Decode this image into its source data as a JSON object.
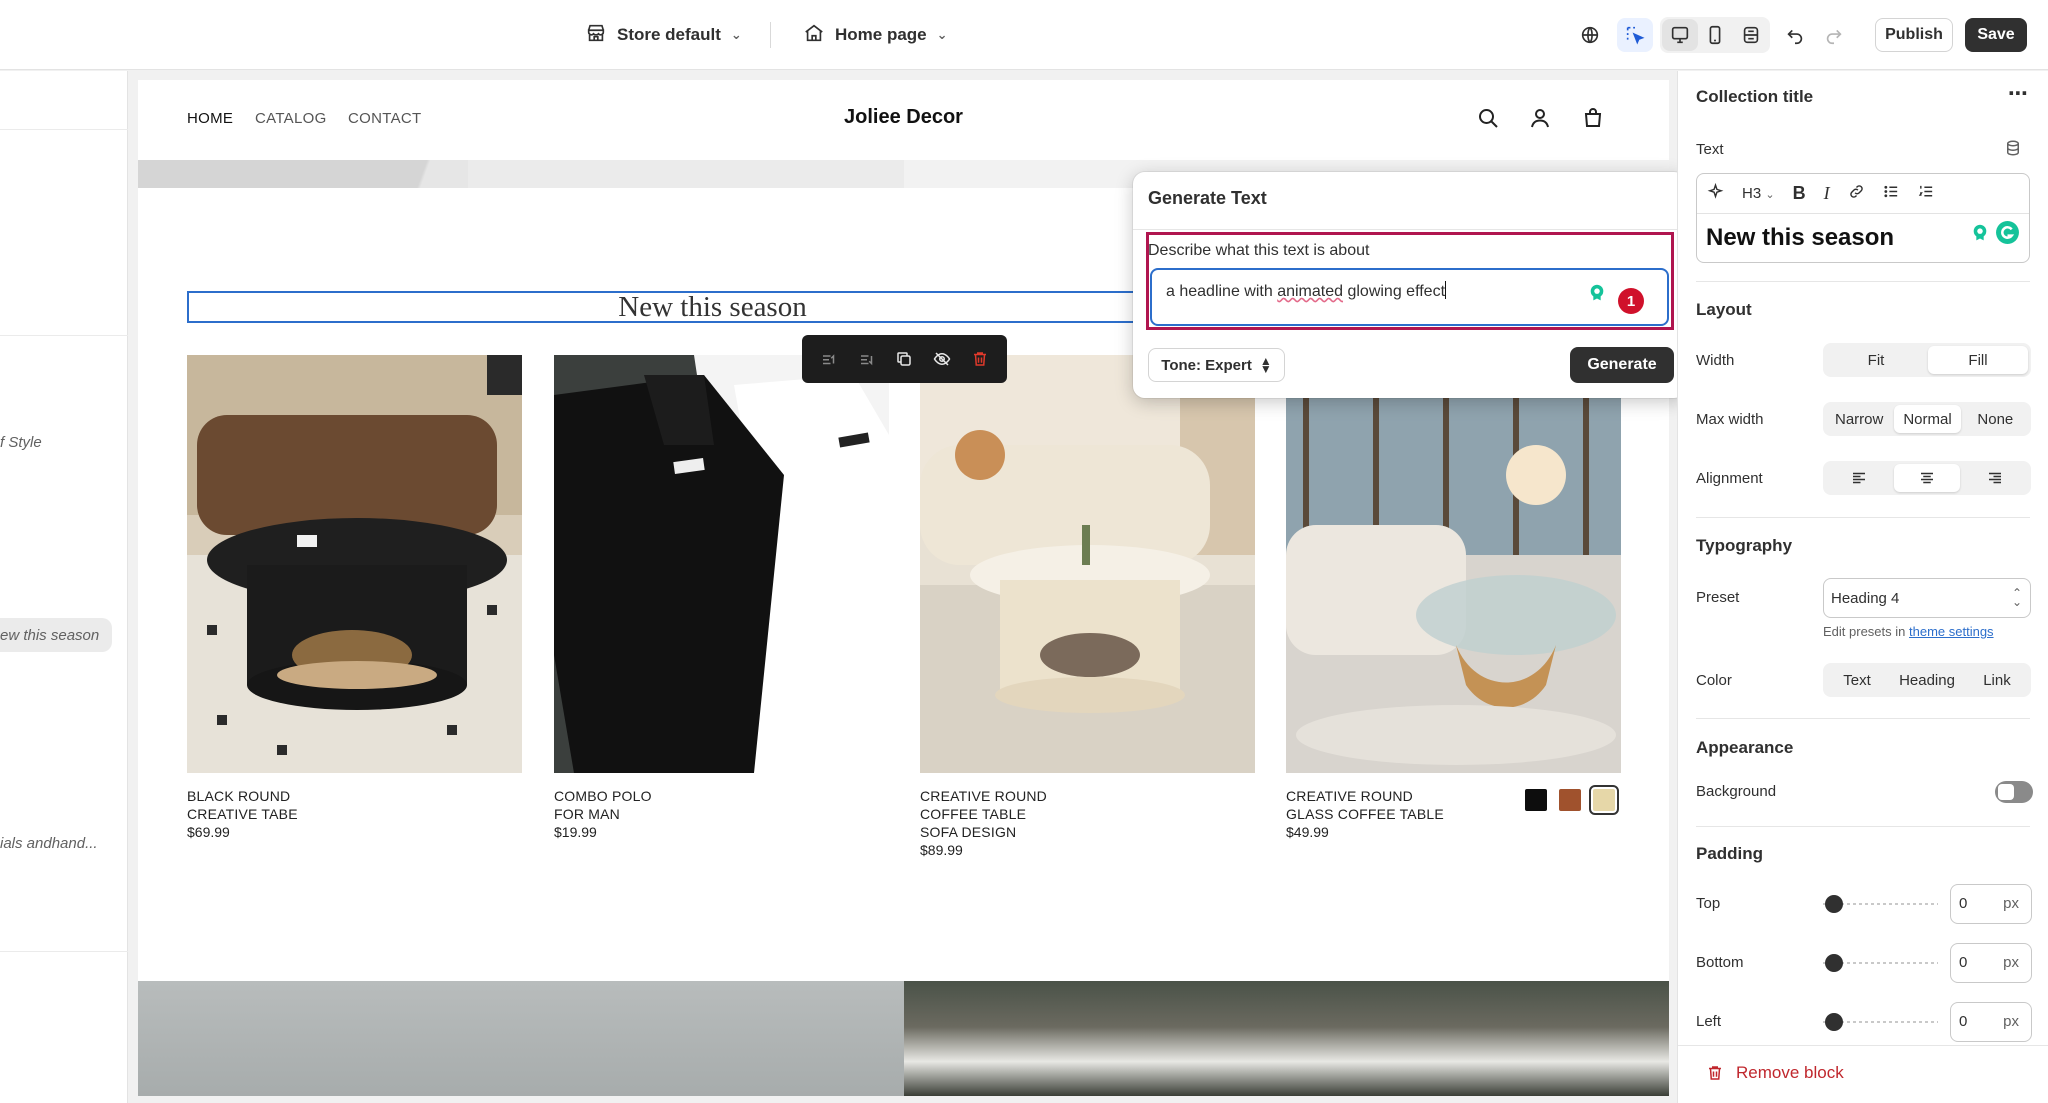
{
  "topbar": {
    "store_select": "Store default",
    "page_select": "Home page",
    "publish_label": "Publish",
    "save_label": "Save"
  },
  "left_panel": {
    "items": [
      "f Style",
      "ew this season",
      "ials andhand..."
    ]
  },
  "storefront": {
    "nav": [
      "HOME",
      "CATALOG",
      "CONTACT"
    ],
    "brand": "Joliee Decor",
    "section_title": "New this season",
    "products": [
      {
        "name": "BLACK ROUND\nCREATIVE TABE",
        "price": "$69.99"
      },
      {
        "name": "COMBO POLO\nFOR MAN",
        "price": "$19.99"
      },
      {
        "name": "CREATIVE ROUND\nCOFFEE TABLE\nSOFA DESIGN",
        "price": "$89.99"
      },
      {
        "name": "CREATIVE ROUND\nGLASS COFFEE TABLE",
        "price": "$49.99"
      }
    ],
    "swatch_colors": [
      "#0d0d0d",
      "#a0522d",
      "#e6d7a8"
    ]
  },
  "generate_text": {
    "title": "Generate Text",
    "prompt_label": "Describe what this text is about",
    "prompt_before": "a headline with ",
    "prompt_spell": "animated",
    "prompt_after": " glowing effect",
    "badge_count": "1",
    "tone_label": "Tone: Expert",
    "generate_label": "Generate"
  },
  "settings": {
    "panel_title": "Collection title",
    "text_label": "Text",
    "heading_level": "H3",
    "text_value": "New this season",
    "layout_heading": "Layout",
    "width_label": "Width",
    "width_options": [
      "Fit",
      "Fill"
    ],
    "width_selected": "Fill",
    "max_width_label": "Max width",
    "max_width_options": [
      "Narrow",
      "Normal",
      "None"
    ],
    "max_width_selected": "Normal",
    "alignment_label": "Alignment",
    "alignment_selected": "center",
    "typography_heading": "Typography",
    "preset_label": "Preset",
    "preset_value": "Heading 4",
    "preset_hint": "Edit presets in",
    "preset_hint_link": "theme settings",
    "color_label": "Color",
    "color_options": [
      "Text",
      "Heading",
      "Link"
    ],
    "appearance_heading": "Appearance",
    "background_label": "Background",
    "background_on": false,
    "padding_heading": "Padding",
    "padding": [
      {
        "label": "Top",
        "value": "0",
        "unit": "px"
      },
      {
        "label": "Bottom",
        "value": "0",
        "unit": "px"
      },
      {
        "label": "Left",
        "value": "0",
        "unit": "px"
      }
    ],
    "remove_label": "Remove block"
  },
  "colors": {
    "accent_blue": "#2c6ecb",
    "focus_frame": "#b0154f",
    "danger": "#c0272d",
    "primary_button": "#303030"
  }
}
